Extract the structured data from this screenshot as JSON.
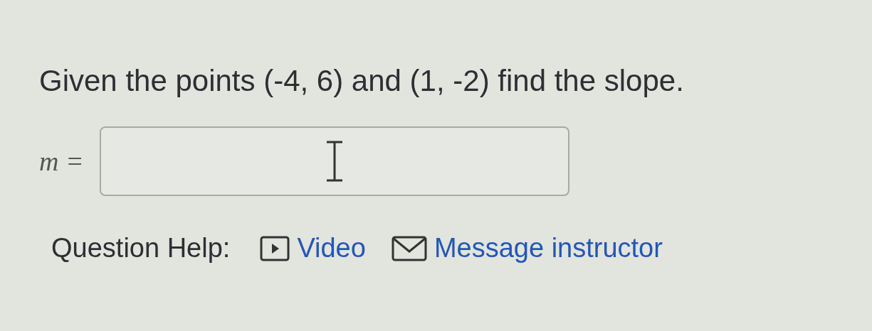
{
  "question": "Given the points (-4, 6) and (1, -2) find the slope.",
  "answer": {
    "label": "m =",
    "placeholder_cursor": true
  },
  "help": {
    "label": "Question Help:",
    "links": [
      {
        "kind": "video",
        "label": "Video"
      },
      {
        "kind": "message",
        "label": "Message instructor"
      }
    ]
  }
}
